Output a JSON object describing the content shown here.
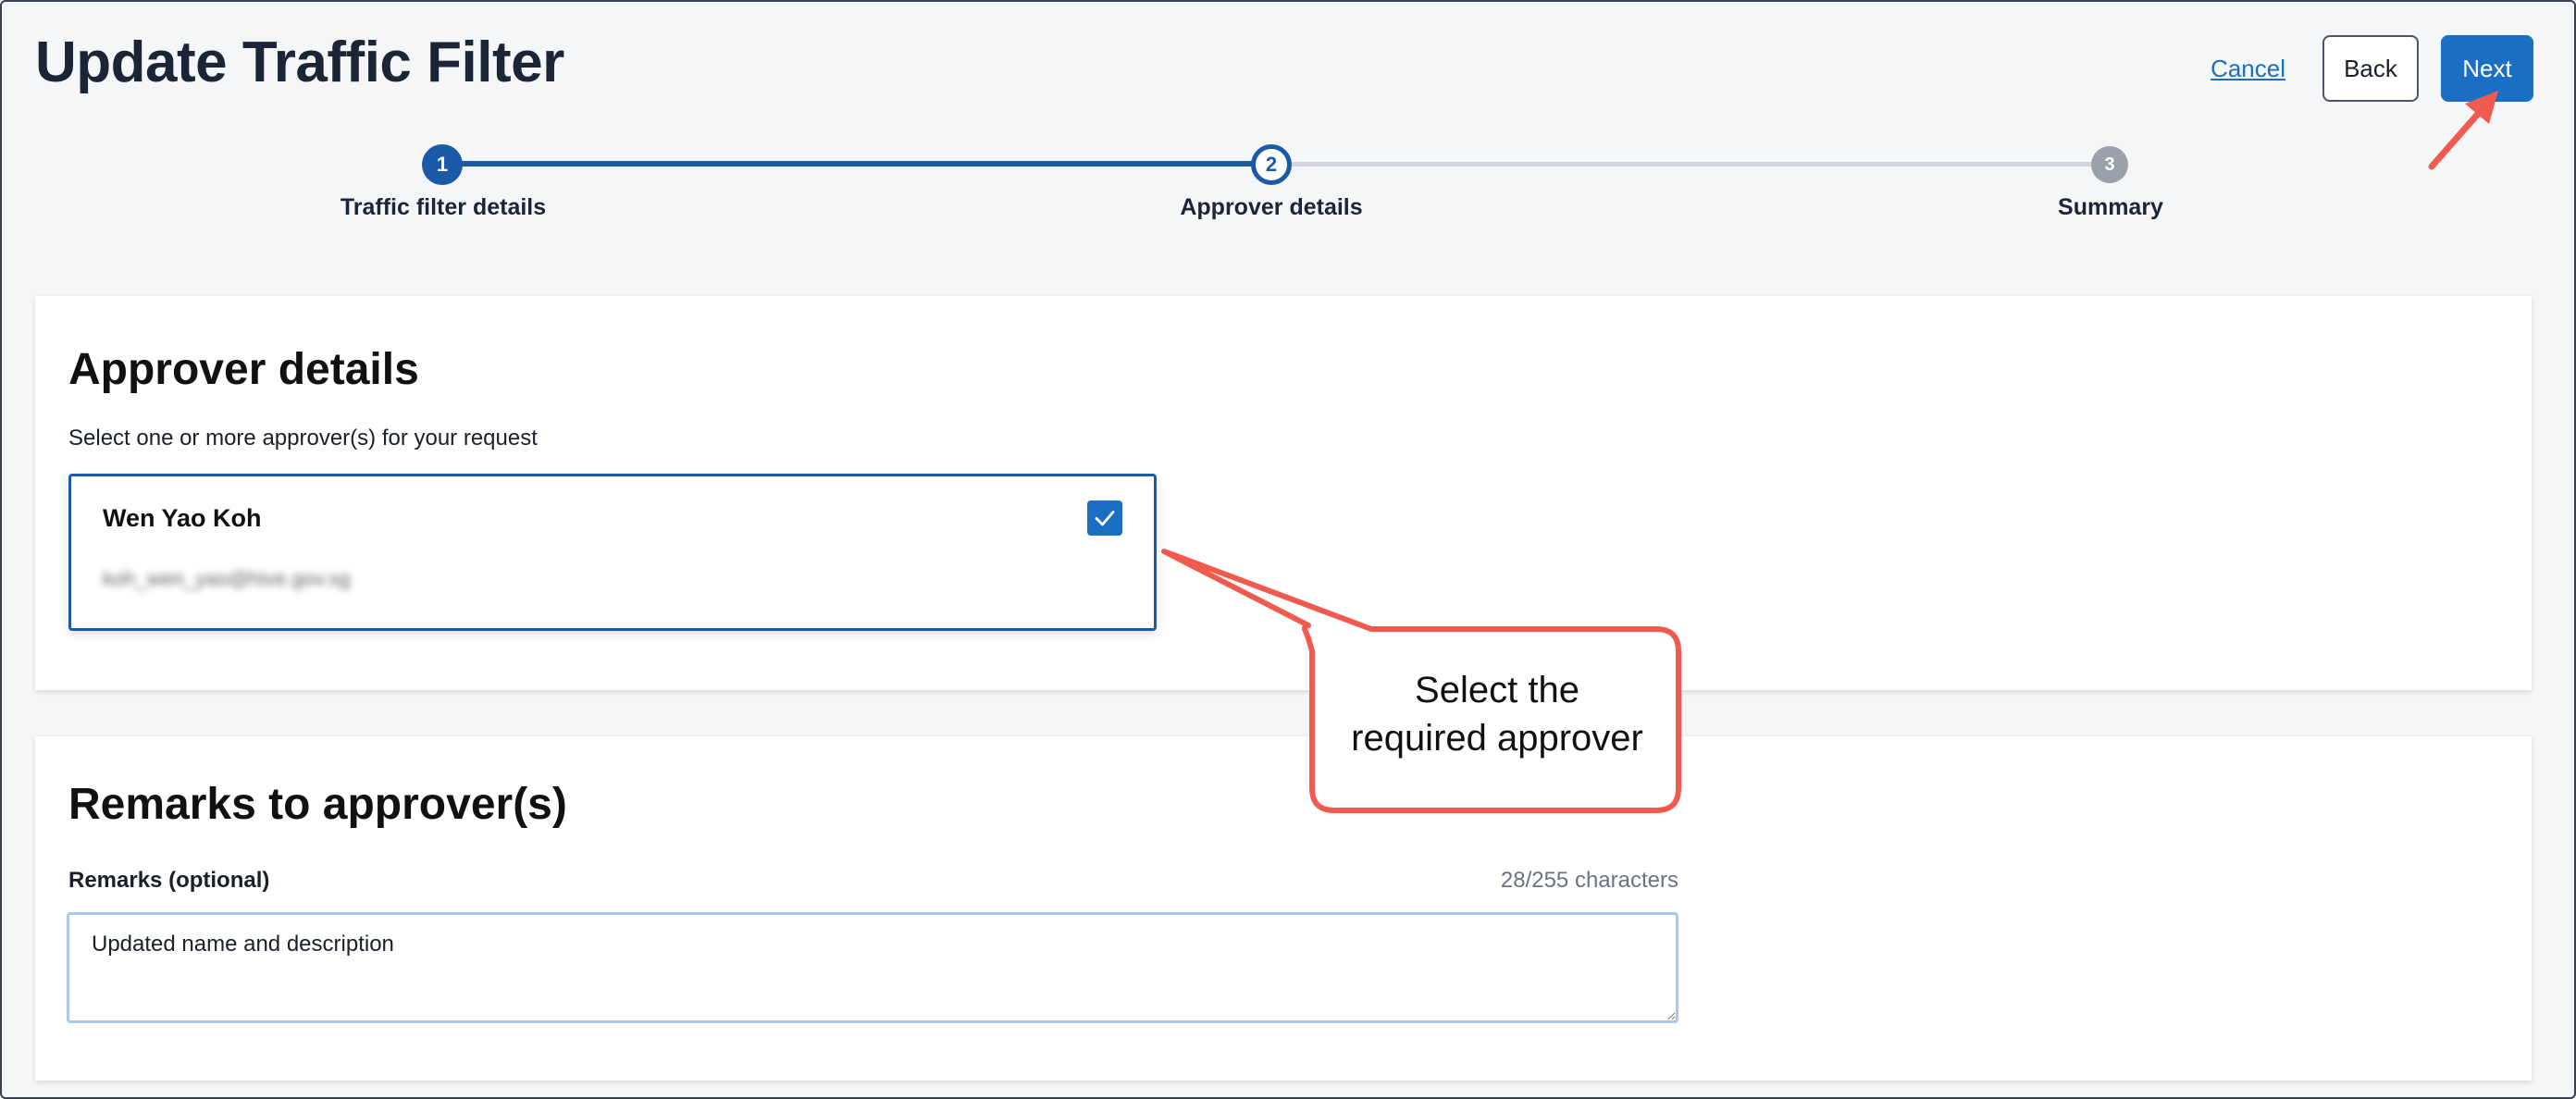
{
  "header": {
    "title": "Update Traffic Filter",
    "cancel_label": "Cancel",
    "back_label": "Back",
    "next_label": "Next"
  },
  "stepper": {
    "steps": [
      {
        "number": "1",
        "label": "Traffic filter details",
        "state": "done"
      },
      {
        "number": "2",
        "label": "Approver details",
        "state": "active"
      },
      {
        "number": "3",
        "label": "Summary",
        "state": "todo"
      }
    ]
  },
  "approver_section": {
    "title": "Approver details",
    "hint": "Select one or more approver(s) for your request",
    "approvers": [
      {
        "name": "Wen Yao Koh",
        "email": "koh_wen_yao@hive.gov.sg",
        "selected": true
      }
    ]
  },
  "remarks_section": {
    "title": "Remarks to approver(s)",
    "label": "Remarks (optional)",
    "char_count": "28/255 characters",
    "value": "Updated name and description"
  },
  "annotation": {
    "callout_line1": "Select the",
    "callout_line2": "required approver",
    "color": "#f05a4f"
  },
  "colors": {
    "primary": "#1a6fc4",
    "step_done": "#1a5aa6",
    "step_todo": "#9aa1ab"
  }
}
